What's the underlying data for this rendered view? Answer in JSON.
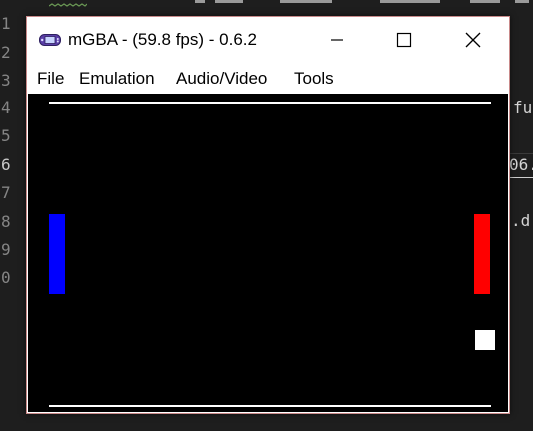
{
  "editor": {
    "line_numbers": [
      "1",
      "2",
      "3",
      "4",
      "5",
      "6",
      "7",
      "8",
      "9",
      "0"
    ],
    "active_line": "6",
    "fragments": {
      "right_line4": "fu",
      "right_line6": "06.",
      "right_line8": ".d"
    }
  },
  "window": {
    "title": "mGBA -  (59.8 fps) - 0.6.2",
    "menu": [
      "File",
      "Emulation",
      "Audio/Video",
      "Tools"
    ]
  },
  "game": {
    "left_paddle_color": "#0000ff",
    "right_paddle_color": "#ff0000",
    "ball_color": "#ffffff",
    "wall_color": "#ffffff",
    "background_color": "#000000"
  },
  "colors": {
    "editor_bg": "#1e1e1e",
    "line_number": "#858585",
    "window_border": "#c98a8a",
    "squiggle": "#6a9955"
  }
}
